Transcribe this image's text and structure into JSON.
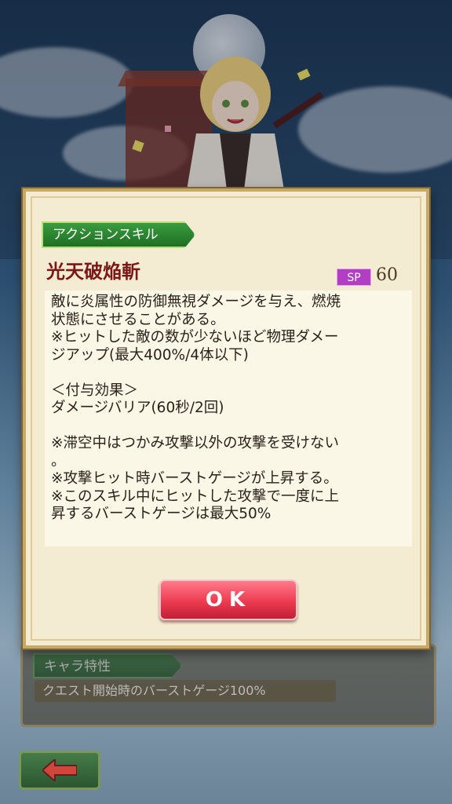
{
  "dialog": {
    "tag_label": "アクションスキル",
    "skill_name": "光天破焔斬",
    "sp_label": "SP",
    "sp_value": "60",
    "description_lines": [
      "敵に炎属性の防御無視ダメージを与え、燃焼",
      "状態にさせることがある。",
      "※ヒットした敵の数が少ないほど物理ダメー",
      "ジアップ(最大400%/4体以下)",
      "",
      "＜付与効果＞",
      "ダメージバリア(60秒/2回)",
      "",
      "※滞空中はつかみ攻撃以外の攻撃を受けない",
      "。",
      "※攻撃ヒット時バーストゲージが上昇する。",
      "※このスキル中にヒットした攻撃で一度に上",
      "昇するバーストゲージは最大50%"
    ],
    "ok_label": "OK"
  },
  "background": {
    "trait_label": "キャラ特性",
    "trait_value": "クエスト開始時のバーストゲージ100%"
  },
  "icons": {
    "back": "back-arrow-icon"
  },
  "colors": {
    "skill_name": "#7a1818",
    "sp_badge": "#b23ec4",
    "ok_button": "#ec3b50",
    "tag_green": "#2f8a33"
  }
}
